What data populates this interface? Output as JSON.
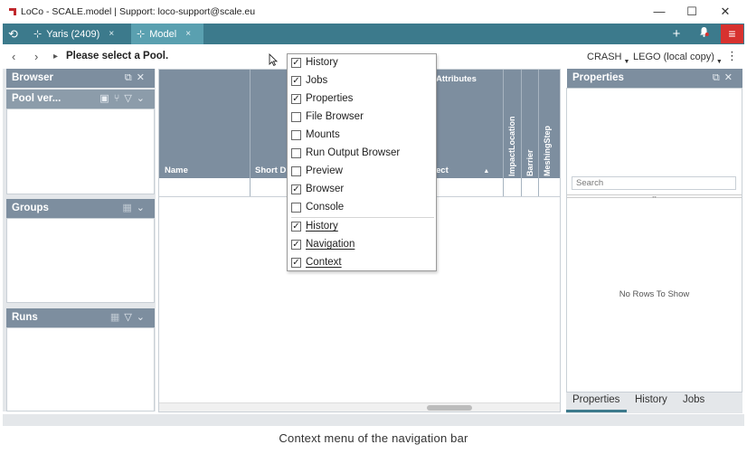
{
  "window": {
    "title": "LoCo - SCALE.model | Support: loco-support@scale.eu",
    "minimize": "—",
    "maximize": "☐",
    "close": "✕"
  },
  "tabs": [
    {
      "label": "Yaris (2409)",
      "close": "×"
    },
    {
      "label": "Model",
      "close": "×"
    }
  ],
  "toolbar": {
    "add": "+",
    "notify": "🔔",
    "menu": "≡"
  },
  "nav": {
    "back": "‹",
    "forward": "›",
    "expand": "▸",
    "path": "Please select a Pool.",
    "crash": "CRASH",
    "lego": "LEGO (local copy)",
    "more": "⋮"
  },
  "browser": {
    "title": "Browser",
    "pool_header": "Pool ver..."
  },
  "groups": {
    "title": "Groups"
  },
  "runs": {
    "title": "Runs"
  },
  "table": {
    "attributes_label": "Attributes",
    "columns": [
      "Name",
      "Short D",
      "ect"
    ],
    "vertical_columns": [
      "ImpactLocation",
      "Barrier",
      "MeshingStep"
    ]
  },
  "properties": {
    "title": "Properties",
    "search_placeholder": "Search",
    "split": "↔",
    "no_rows": "No Rows To Show",
    "tabs": [
      "Properties",
      "History",
      "Jobs"
    ]
  },
  "context_menu": {
    "items": [
      {
        "label": "History",
        "checked": true
      },
      {
        "label": "Jobs",
        "checked": true
      },
      {
        "label": "Properties",
        "checked": true
      },
      {
        "label": "File Browser",
        "checked": false
      },
      {
        "label": "Mounts",
        "checked": false
      },
      {
        "label": "Run Output Browser",
        "checked": false
      },
      {
        "label": "Preview",
        "checked": false
      },
      {
        "label": "Browser",
        "checked": true
      },
      {
        "label": "Console",
        "checked": false
      },
      {
        "label": "History",
        "checked": true
      },
      {
        "label": "Navigation",
        "checked": true
      },
      {
        "label": "Context",
        "checked": true
      }
    ]
  },
  "caption": "Context menu of the navigation bar",
  "colors": {
    "tabbar": "#3c7a8c",
    "tab_active": "#5aa0b0",
    "panel_header": "#7d8e9f",
    "menu_button": "#d7322f",
    "logo": "#c0282c"
  }
}
